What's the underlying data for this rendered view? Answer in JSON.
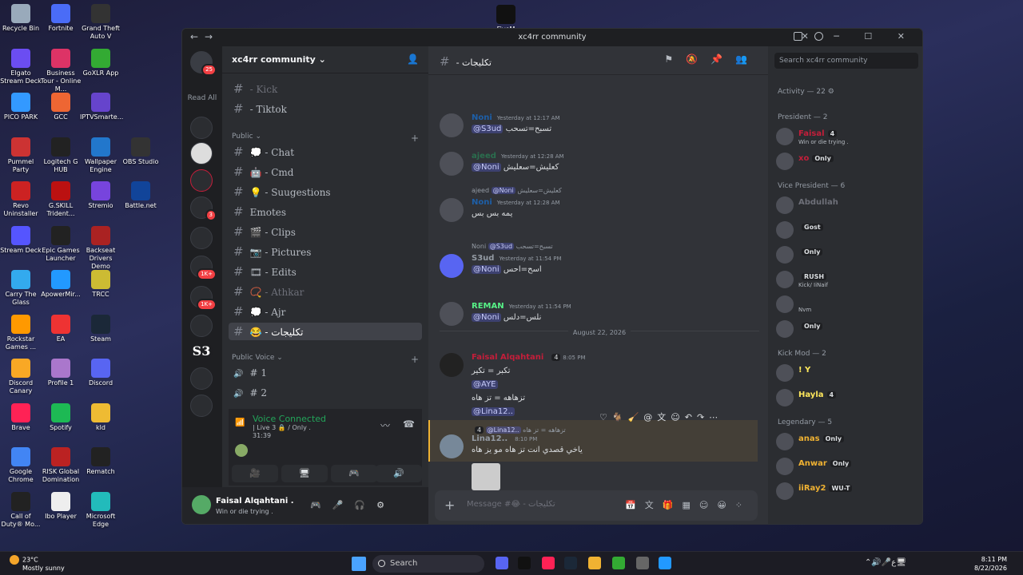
{
  "desktop": {
    "icons": [
      {
        "label": "Recycle Bin",
        "color": "#9ab"
      },
      {
        "label": "Fortnite",
        "color": "#4a6cf7"
      },
      {
        "label": "Grand Theft Auto V",
        "color": "#333"
      },
      {
        "label": "Elgato Stream Deck",
        "color": "#6b4df2"
      },
      {
        "label": "Business Tour - Online M...",
        "color": "#d36"
      },
      {
        "label": "GoXLR App",
        "color": "#3a3"
      },
      {
        "label": "PICO PARK",
        "color": "#39f"
      },
      {
        "label": "GCC",
        "color": "#e63"
      },
      {
        "label": "IPTVSmarte...",
        "color": "#64c"
      },
      {
        "label": "Pummel Party",
        "color": "#c33"
      },
      {
        "label": "Logitech G HUB",
        "color": "#222"
      },
      {
        "label": "Wallpaper Engine",
        "color": "#27c"
      },
      {
        "label": "OBS Studio",
        "color": "#333"
      },
      {
        "label": "Revo Uninstaller",
        "color": "#c22"
      },
      {
        "label": "G.SKILL Trident...",
        "color": "#b11"
      },
      {
        "label": "Stremio",
        "color": "#74d"
      },
      {
        "label": "Battle.net",
        "color": "#149"
      },
      {
        "label": "Stream Deck",
        "color": "#55f"
      },
      {
        "label": "Epic Games Launcher",
        "color": "#222"
      },
      {
        "label": "Backseat Drivers Demo",
        "color": "#a22"
      },
      {
        "label": "Carry The Glass",
        "color": "#3ae"
      },
      {
        "label": "ApowerMir...",
        "color": "#29f"
      },
      {
        "label": "TRCC",
        "color": "#cb3"
      },
      {
        "label": "Rockstar Games ...",
        "color": "#f90"
      },
      {
        "label": "EA",
        "color": "#e33"
      },
      {
        "label": "Steam",
        "color": "#1b2838"
      },
      {
        "label": "Discord Canary",
        "color": "#f9a825"
      },
      {
        "label": "Profile 1",
        "color": "#a7c"
      },
      {
        "label": "Discord",
        "color": "#5865f2"
      },
      {
        "label": "Brave",
        "color": "#f25"
      },
      {
        "label": "Spotify",
        "color": "#1db954"
      },
      {
        "label": "kld",
        "color": "#eb3"
      },
      {
        "label": "Google Chrome",
        "color": "#4285f4"
      },
      {
        "label": "RISK Global Domination",
        "color": "#b22"
      },
      {
        "label": "Rematch",
        "color": "#222"
      },
      {
        "label": "Call of Duty® Mo...",
        "color": "#222"
      },
      {
        "label": "Ibo Player",
        "color": "#eee"
      },
      {
        "label": "Microsoft Edge",
        "color": "#2bb"
      }
    ],
    "top_app": "FiveM"
  },
  "taskbar": {
    "temp": "23°C",
    "weather": "Mostly sunny",
    "search_placeholder": "Search",
    "time": "8:11 PM",
    "date": "8/22/2026",
    "lang": "ع"
  },
  "window": {
    "title": "xc4rr community"
  },
  "servers": {
    "home_badge": "25",
    "read_all": "Read All",
    "badges": [
      "3",
      "1K+",
      "1K+"
    ],
    "s3_label": "S3"
  },
  "sidebar": {
    "server_name": "xc4rr community",
    "channels_top": [
      {
        "name": "- Kick",
        "muted": true
      },
      {
        "name": "- Tiktok",
        "muted": false
      }
    ],
    "public_label": "Public",
    "public_channels": [
      {
        "name": "- Chat",
        "emoji": "💭"
      },
      {
        "name": "- Cmd",
        "emoji": "🤖"
      },
      {
        "name": "- Suugestions",
        "emoji": "💡"
      },
      {
        "name": "Emotes",
        "emoji": ""
      },
      {
        "name": "- Clips",
        "emoji": "🎬"
      },
      {
        "name": "- Pictures",
        "emoji": "📷"
      },
      {
        "name": "- Edits",
        "emoji": "🎞"
      },
      {
        "name": "- Athkar",
        "emoji": "📿"
      },
      {
        "name": "- Ajr",
        "emoji": "💭"
      },
      {
        "name": "- تكليجات",
        "emoji": "😂"
      }
    ],
    "voice_label": "Public Voice",
    "voice_channels": [
      "# 1",
      "# 2"
    ]
  },
  "voice": {
    "status": "Voice Connected",
    "channel": "| Live 3 🔒 / Only .",
    "elapsed": "31:39"
  },
  "user": {
    "name": "Faisal Alqahtani .",
    "status": "Win or die trying ."
  },
  "chat": {
    "channel": "- تكليجات",
    "messages": [
      {
        "name": "Noni",
        "color": "#1d5fa8",
        "time": "Yesterday at 12:17 AM",
        "mention": "@S3ud",
        "text": "تسبح=تسحب"
      },
      {
        "name": "ajeed",
        "color": "#2a6e4e",
        "time": "Yesterday at 12:28 AM",
        "mention": "@Noni",
        "text": "كعليش=سعليش"
      },
      {
        "name": "Noni",
        "color": "#1d5fa8",
        "time": "Yesterday at 12:28 AM",
        "mention": "",
        "text": "يمه بس بس",
        "reply_mention": "@Noni",
        "reply_text": "كعليش=سعليش",
        "reply_name": "ajeed"
      },
      {
        "name": "S3ud",
        "color": "#949ba4",
        "time": "Yesterday at 11:54 PM",
        "mention": "@Noni",
        "text": "اسح=احس",
        "reply_mention": "@S3ud",
        "reply_text": "تسبح=تسحب",
        "reply_name": "Noni"
      },
      {
        "name": "REMAN",
        "color": "#57f287",
        "time": "Yesterday at 11:54 PM",
        "mention": "@Noni",
        "text": "نلس=دلس"
      }
    ],
    "date_divider": "August 22, 2026",
    "big_msg": {
      "name": "Faisal Alqahtani",
      "time": "8:05 PM",
      "badge": "4",
      "lines": [
        "تكبر = تكير",
        "@AYE",
        "تزهاهه = تز هاه",
        "@Lina12.."
      ]
    },
    "last_msg": {
      "name": "Lina12..",
      "time": "8:10 PM",
      "text": "ياخي قصدي انت تز هاه مو يز هاه",
      "reply_mention": "@Lina12..",
      "reply_text": "تزهاهه = تز هاه",
      "reply_badge": "4"
    },
    "composer_placeholder": "Message #😂 - تكليجات"
  },
  "members": {
    "search_placeholder": "Search xc4rr community",
    "activity": "Activity — 22",
    "groups": [
      {
        "label": "President — 2",
        "members": [
          {
            "name": "Faisal",
            "color": "#c41e3a",
            "status": "Win or die trying .",
            "tag": "4"
          },
          {
            "name": "xo",
            "color": "#c41e3a",
            "status": "",
            "tag": "Only"
          }
        ]
      },
      {
        "label": "Vice President — 6",
        "members": [
          {
            "name": "Abdullah",
            "color": "#6d6f78",
            "status": "",
            "tag": ""
          },
          {
            "name": "",
            "color": "#f2f3f5",
            "status": "",
            "tag": "Gost"
          },
          {
            "name": "",
            "color": "#f2f3f5",
            "status": "",
            "tag": "Only"
          },
          {
            "name": "",
            "color": "#f2f3f5",
            "status": "Kick/ IiNaif",
            "tag": "RUSH"
          },
          {
            "name": "",
            "color": "#f2f3f5",
            "status": "Nvm",
            "tag": ""
          },
          {
            "name": "",
            "color": "#f2f3f5",
            "status": "",
            "tag": "Only"
          }
        ]
      },
      {
        "label": "Kick Mod — 2",
        "members": [
          {
            "name": "! Y",
            "color": "#fee75c",
            "status": "",
            "tag": ""
          },
          {
            "name": "Hayla",
            "color": "#fee75c",
            "status": "",
            "tag": "4"
          }
        ]
      },
      {
        "label": "Legendary — 5",
        "members": [
          {
            "name": "anas",
            "color": "#f0b232",
            "status": "",
            "tag": "Only"
          },
          {
            "name": "Anwar",
            "color": "#f0b232",
            "status": "",
            "tag": "Only"
          },
          {
            "name": "iiRay2",
            "color": "#f0b232",
            "status": "",
            "tag": "WU-T"
          }
        ]
      }
    ]
  }
}
